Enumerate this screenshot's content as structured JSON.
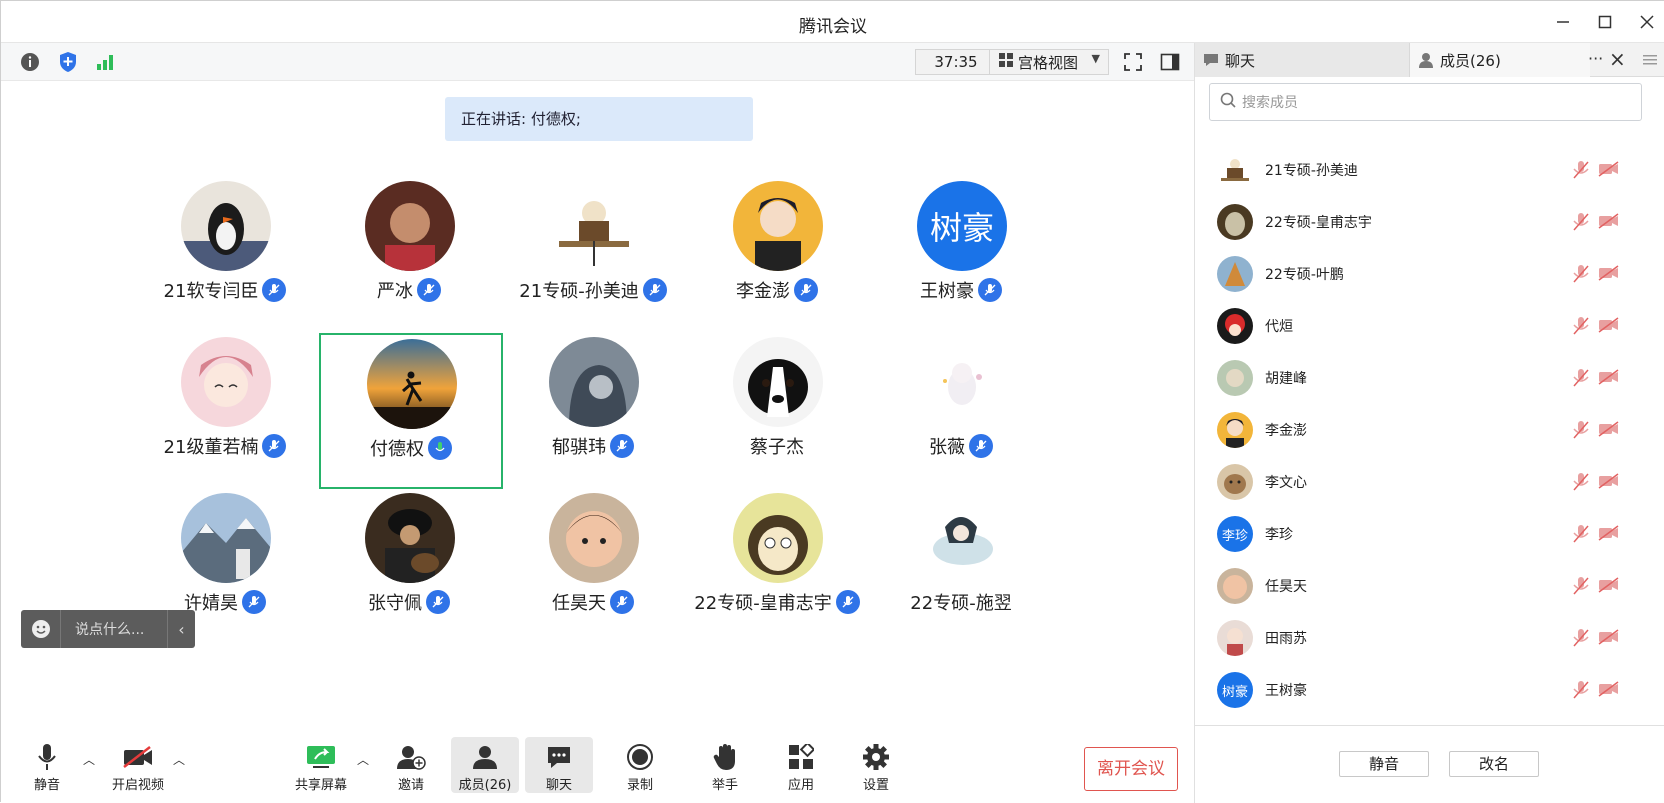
{
  "window": {
    "title": "腾讯会议"
  },
  "topbar": {
    "timer": "37:35",
    "view_label": "宫格视图"
  },
  "speaking": {
    "text": "正在讲话: 付德权;"
  },
  "grid": {
    "tiles": [
      {
        "name": "21软专闫臣"
      },
      {
        "name": "严冰"
      },
      {
        "name": "21专硕-孙美迪"
      },
      {
        "name": "李金澎"
      },
      {
        "name": "王树豪",
        "avatar_text": "树豪"
      },
      {
        "name": "21级董若楠"
      },
      {
        "name": "付德权"
      },
      {
        "name": "郁骐玮"
      },
      {
        "name": "蔡子杰"
      },
      {
        "name": "张薇"
      },
      {
        "name": "许婧昊"
      },
      {
        "name": "张守佩"
      },
      {
        "name": "任昊天"
      },
      {
        "name": "22专硕-皇甫志宇"
      },
      {
        "name": "22专硕-施翌"
      }
    ]
  },
  "chatbox": {
    "placeholder": "说点什么..."
  },
  "bottombar": {
    "mute": "静音",
    "video": "开启视频",
    "share": "共享屏幕",
    "invite": "邀请",
    "members": "成员(26)",
    "chat": "聊天",
    "record": "录制",
    "raise_hand": "举手",
    "apps": "应用",
    "settings": "设置",
    "leave": "离开会议"
  },
  "panel": {
    "tab_chat": "聊天",
    "tab_members": "成员(26)",
    "search_placeholder": "搜索成员",
    "members": [
      {
        "name": "21专硕-孙美迪"
      },
      {
        "name": "22专硕-皇甫志宇"
      },
      {
        "name": "22专硕-叶鹏"
      },
      {
        "name": "代烜"
      },
      {
        "name": "胡建峰"
      },
      {
        "name": "李金澎"
      },
      {
        "name": "李文心"
      },
      {
        "name": "李珍",
        "avatar_text": "李珍"
      },
      {
        "name": "任昊天"
      },
      {
        "name": "田雨苏"
      },
      {
        "name": "王树豪",
        "avatar_text": "树豪"
      }
    ],
    "mute_btn": "静音",
    "rename_btn": "改名"
  },
  "colors": {
    "accent": "#2f73e8",
    "active_border": "#27b36a",
    "leave": "#e0554f"
  }
}
